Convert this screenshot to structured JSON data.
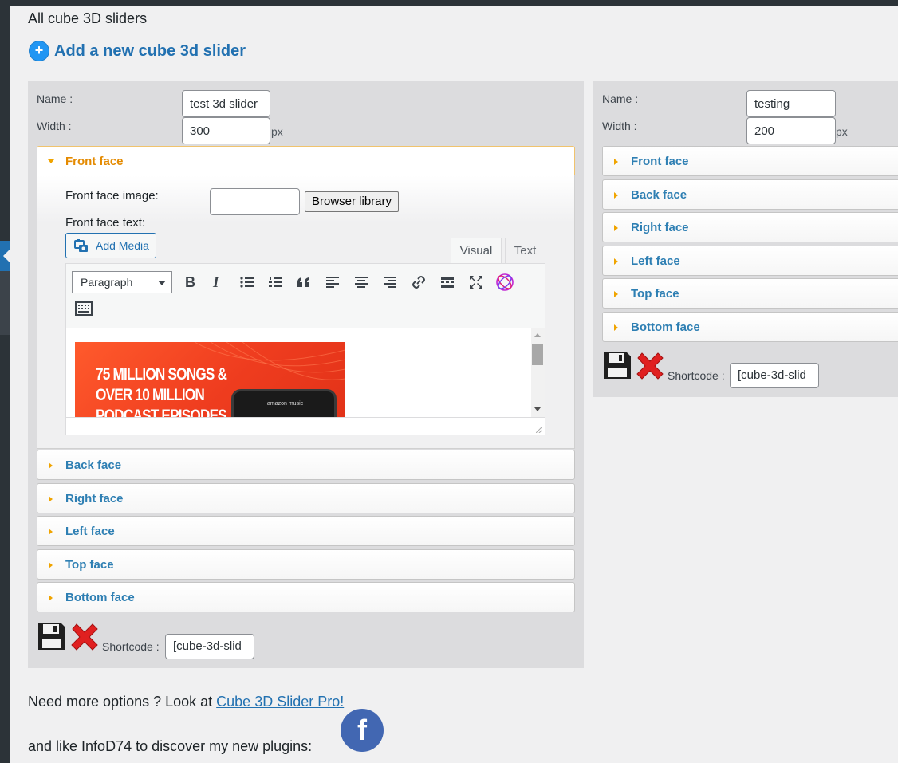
{
  "header": {
    "title": "All cube 3D sliders",
    "add_new_label": "Add a new cube 3d slider"
  },
  "labels": {
    "name": "Name :",
    "width": "Width :",
    "px": "px",
    "shortcode": "Shortcode :"
  },
  "slider1": {
    "name_value": "test 3d slider",
    "width_value": "300",
    "open_face": "Front face",
    "image_label": "Front face image:",
    "image_value": "",
    "browse_label": "Browser library",
    "text_label": "Front face text:",
    "add_media_label": "Add Media",
    "tab_visual": "Visual",
    "tab_text": "Text",
    "format_selected": "Paragraph",
    "editor_image": {
      "text": "75 MILLION SONGS &\nOVER 10 MILLION\nPODCAST EPISODES",
      "phone_label": "amazon music"
    },
    "collapsed_faces": [
      "Back face",
      "Right face",
      "Left face",
      "Top face",
      "Bottom face"
    ],
    "shortcode_value": "[cube-3d-slid"
  },
  "slider2": {
    "name_value": "testing",
    "width_value": "200",
    "faces": [
      "Front face",
      "Back face",
      "Right face",
      "Left face",
      "Top face",
      "Bottom face"
    ],
    "shortcode_value": "[cube-3d-slid"
  },
  "footer": {
    "more_prefix": "Need more options ? Look at ",
    "pro_link": "Cube 3D Slider Pro!",
    "like_text": "and like InfoD74 to discover my new plugins:",
    "fb_letter": "f"
  },
  "colors": {
    "accent": "#2271b1",
    "face_label": "#2e7fb3",
    "open_face_label": "#e48a00",
    "caret": "#f0a400",
    "delete": "#e02020"
  }
}
